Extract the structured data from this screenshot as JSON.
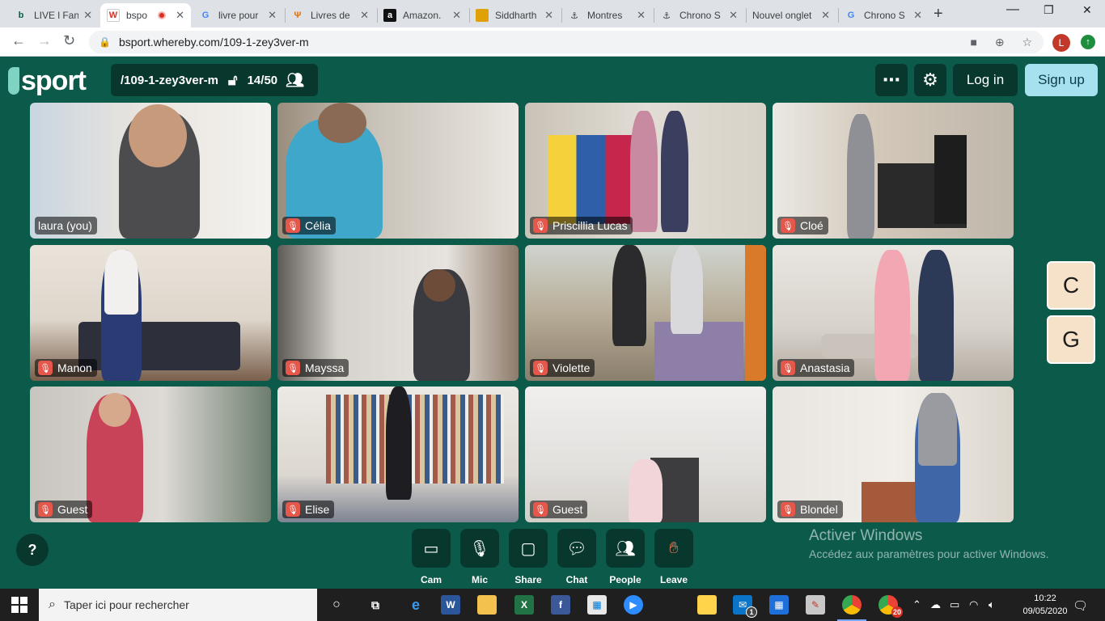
{
  "browser": {
    "tabs": [
      {
        "title": "LIVE l Fan",
        "favicon": "b",
        "favicon_color": "#0c5a4a"
      },
      {
        "title": "bspo",
        "favicon": "W",
        "favicon_color": "#d93025",
        "recording": true,
        "active": true
      },
      {
        "title": "livre pour",
        "favicon": "G",
        "favicon_color": "#4285f4"
      },
      {
        "title": "Livres de",
        "favicon": "Ψ",
        "favicon_color": "#e8710a"
      },
      {
        "title": "Amazon.",
        "favicon": "a",
        "favicon_color": "#111111"
      },
      {
        "title": "Siddharth",
        "favicon": "▬",
        "favicon_color": "#e0a106"
      },
      {
        "title": "Montres",
        "favicon": "⚓",
        "favicon_color": "#3c4043"
      },
      {
        "title": "Chrono S",
        "favicon": "⚓",
        "favicon_color": "#3c4043"
      },
      {
        "title": "Nouvel onglet",
        "favicon": "",
        "favicon_color": "#dee1e6"
      },
      {
        "title": "Chrono S",
        "favicon": "G",
        "favicon_color": "#4285f4"
      }
    ],
    "url": "bsport.whereby.com/109-1-zey3ver-m",
    "profile_initial": "L"
  },
  "header": {
    "logo": "bsport",
    "room": "/109-1-zey3ver-m",
    "participants": "14/50",
    "login": "Log in",
    "signup": "Sign up"
  },
  "participants": [
    {
      "name": "laura (you)",
      "muted": false
    },
    {
      "name": "Célia",
      "muted": true
    },
    {
      "name": "Priscillia Lucas",
      "muted": true
    },
    {
      "name": "Cloé",
      "muted": true
    },
    {
      "name": "Manon",
      "muted": true
    },
    {
      "name": "Mayssa",
      "muted": true
    },
    {
      "name": "Violette",
      "muted": true
    },
    {
      "name": "Anastasia",
      "muted": true
    },
    {
      "name": "Guest",
      "muted": true
    },
    {
      "name": "Elise",
      "muted": true
    },
    {
      "name": "Guest",
      "muted": true
    },
    {
      "name": "Blondel",
      "muted": true
    }
  ],
  "side_chips": [
    "C",
    "G"
  ],
  "controls": {
    "help": "?",
    "cam": "Cam",
    "mic": "Mic",
    "share": "Share",
    "chat": "Chat",
    "people": "People",
    "leave": "Leave"
  },
  "watermark": {
    "title": "Activer Windows",
    "subtitle": "Accédez aux paramètres pour activer Windows."
  },
  "taskbar": {
    "search_placeholder": "Taper ici pour rechercher",
    "time": "10:22",
    "date": "09/05/2020",
    "mail_badge": "1",
    "chrome_badge": "20"
  },
  "colors": {
    "background": "#0c5a4a",
    "panel": "#08372e",
    "signup": "#a6e1f0",
    "mute": "#e4574a"
  }
}
